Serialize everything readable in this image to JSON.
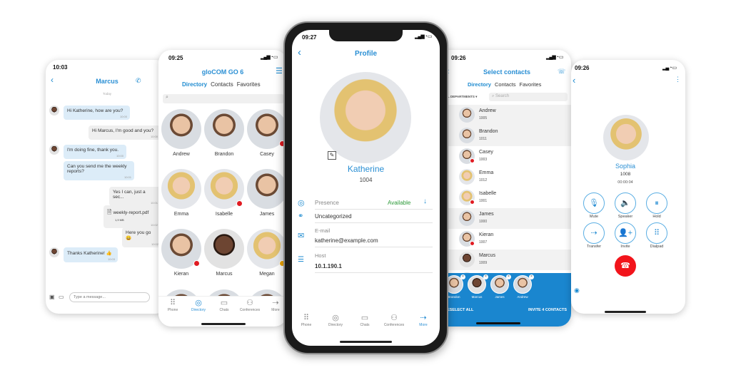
{
  "chat": {
    "time": "10:03",
    "contact": "Marcus",
    "day": "Today",
    "input_placeholder": "Type a message...",
    "messages": [
      {
        "side": "l",
        "text": "Hi Katherine, how are you?",
        "time": "10:00"
      },
      {
        "side": "r",
        "text": "Hi Marcus, I'm good and you?",
        "time": "10:00"
      },
      {
        "side": "l",
        "text": "I'm doing fine, thank you.",
        "time": "10:00"
      },
      {
        "side": "l",
        "text": "Can you send me the weekly reports?",
        "time": "10:01"
      },
      {
        "side": "r",
        "text": "Yes I can, just a sec...",
        "time": "10:01"
      },
      {
        "side": "r",
        "text": "weekly-report.pdf",
        "sub": "1,9 MB",
        "time": "10:02",
        "file": true
      },
      {
        "side": "r",
        "text": "Here you go 😀",
        "time": "10:02"
      },
      {
        "side": "l",
        "text": "Thanks Katherine! 👍",
        "time": "10:03"
      }
    ]
  },
  "directory": {
    "time": "09:25",
    "title": "gloCOM GO 6",
    "tabs": [
      "Directory",
      "Contacts",
      "Favorites"
    ],
    "active_tab": "Directory",
    "contacts": [
      {
        "name": "Andrew"
      },
      {
        "name": "Brandon"
      },
      {
        "name": "Casey",
        "status": "on-call"
      },
      {
        "name": "Emma"
      },
      {
        "name": "Isabelle",
        "status": "dnd"
      },
      {
        "name": "James"
      },
      {
        "name": "Kieran",
        "status": "busy"
      },
      {
        "name": "Marcus"
      },
      {
        "name": "Megan",
        "status": "away"
      }
    ]
  },
  "nav": [
    "Phone",
    "Directory",
    "Chats",
    "Conferences",
    "More"
  ],
  "profile": {
    "time": "09:27",
    "title": "Profile",
    "name": "Katherine",
    "ext": "1004",
    "presence_label": "Presence",
    "presence_value": "Available",
    "group": "Uncategorized",
    "email_label": "E-mail",
    "email": "katherine@example.com",
    "host_label": "Host",
    "host": "10.1.190.1",
    "active_nav": "More"
  },
  "select": {
    "time": "09:26",
    "title": "Select contacts",
    "tabs": [
      "Directory",
      "Contacts",
      "Favorites"
    ],
    "departments": "ALL DEPARTMENTS",
    "search_placeholder": "Search",
    "rows": [
      {
        "name": "Andrew",
        "ext": "1005",
        "checked": true
      },
      {
        "name": "Brandon",
        "ext": "1011",
        "checked": true
      },
      {
        "name": "Casey",
        "ext": "1003",
        "checked": false,
        "status": "on-call"
      },
      {
        "name": "Emma",
        "ext": "1012",
        "checked": false
      },
      {
        "name": "Isabelle",
        "ext": "1001",
        "checked": false,
        "status": "dnd"
      },
      {
        "name": "James",
        "ext": "1000",
        "checked": true
      },
      {
        "name": "Kieran",
        "ext": "1007",
        "checked": false,
        "status": "busy"
      },
      {
        "name": "Marcus",
        "ext": "1009",
        "checked": true
      }
    ],
    "selected": [
      "Brandon",
      "Marcus",
      "James",
      "Andrew"
    ],
    "deselect_label": "DESELECT ALL",
    "invite_label": "INVITE 4 CONTACTS"
  },
  "call": {
    "time": "09:26",
    "name": "Sophia",
    "ext": "1008",
    "duration": "00:00:04",
    "buttons": [
      {
        "label": "Mute",
        "icon": "mic-off-icon",
        "glyph": "🎙"
      },
      {
        "label": "Speaker",
        "icon": "speaker-icon",
        "glyph": "🔈"
      },
      {
        "label": "Hold",
        "icon": "pause-icon",
        "glyph": "⏸"
      },
      {
        "label": "Transfer",
        "icon": "transfer-icon",
        "glyph": "⇢"
      },
      {
        "label": "Invite",
        "icon": "add-person-icon",
        "glyph": "👤+"
      },
      {
        "label": "Dialpad",
        "icon": "dialpad-icon",
        "glyph": "⠿"
      }
    ]
  },
  "colors": {
    "accent": "#2a8fd4",
    "panel": "#1a86cf",
    "available": "#2e9a3a",
    "end_call": "#f2141b"
  }
}
